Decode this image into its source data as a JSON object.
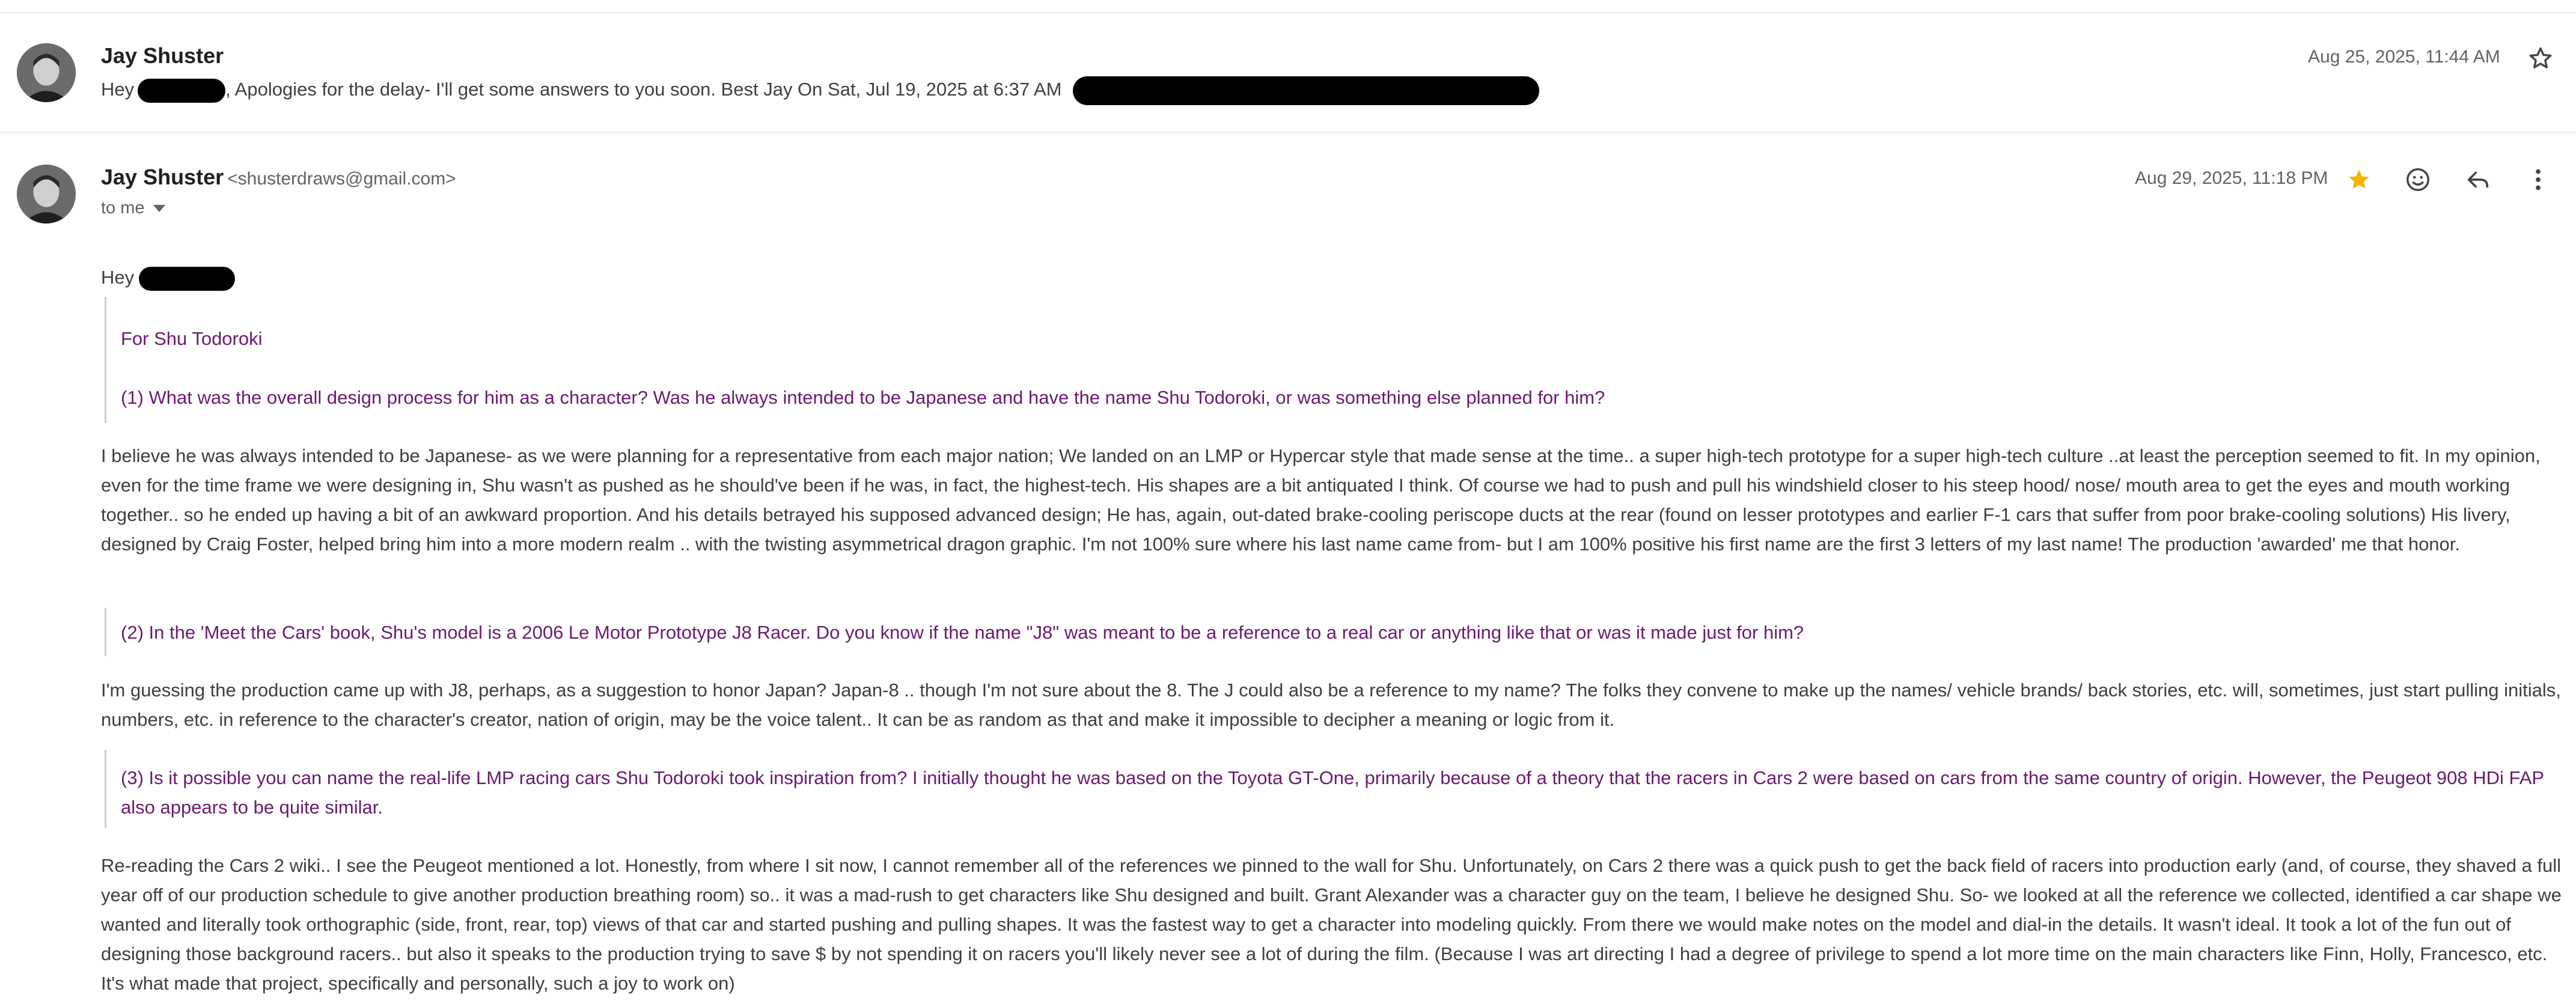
{
  "collapsed_message": {
    "sender": "Jay Shuster",
    "snippet_prefix": "Hey",
    "snippet_text": ", Apologies for the delay- I'll get some answers to you soon. Best Jay On Sat, Jul 19, 2025 at 6:37 AM",
    "date": "Aug 25, 2025, 11:44 AM",
    "star_icon": "star-outline-icon"
  },
  "expanded_message": {
    "sender": "Jay Shuster",
    "email": "<shusterdraws@gmail.com>",
    "recipient": "to me",
    "date": "Aug 29, 2025, 11:18 PM",
    "icons": [
      "star-filled-icon",
      "emoji-icon",
      "reply-icon",
      "more-vert-icon"
    ],
    "colors": {
      "star": "#f4b400",
      "quote": "#6a1b6f",
      "redaction": "#000000"
    },
    "greeting": "Hey",
    "quote_heading": "For Shu Todoroki",
    "q1": "(1) What was the overall design process for him as a character? Was he always intended to be Japanese and have the name Shu Todoroki, or was something else planned for him?",
    "a1": "I believe he was always intended to be Japanese- as we were planning for a representative from each major nation; We landed on an LMP or Hypercar style that made sense at the time.. a super high-tech prototype for a super high-tech culture ..at least the perception seemed to fit. In my opinion, even for the time frame we were designing in, Shu wasn't as pushed as he should've been if he was, in fact, the highest-tech. His shapes are a bit antiquated I think. Of course we had to push and pull his windshield closer to his steep hood/ nose/ mouth area to get the eyes and mouth working together.. so he ended up having a bit of an awkward proportion. And his details betrayed his supposed advanced design; He has, again, out-dated brake-cooling periscope ducts at the rear (found on lesser prototypes and earlier F-1 cars that suffer from poor brake-cooling solutions) His livery, designed by Craig Foster, helped bring him into a more modern realm .. with the twisting asymmetrical dragon graphic. I'm not 100% sure where his last name came from- but I am 100% positive his first name are the first 3 letters of my last name! The production 'awarded' me that honor.",
    "q2": "(2) In the 'Meet the Cars' book, Shu's model is a 2006 Le Motor Prototype J8 Racer. Do you know if the name \"J8\" was meant to be a reference to a real car or anything like that or was it  made just for him?",
    "a2": "I'm guessing the production came up with J8, perhaps, as a suggestion to honor Japan? Japan-8 .. though I'm not sure about the 8. The J could also be a reference to my name? The folks they convene to make up the names/ vehicle brands/ back stories, etc. will, sometimes, just start pulling initials, numbers, etc. in reference to the character's creator, nation of origin, may be the voice talent.. It can be as random as that and make it impossible to decipher a meaning or logic from it.",
    "q3": "(3) Is it possible you can name the real-life LMP racing cars Shu Todoroki took inspiration from? I initially thought he was based on the Toyota GT-One, primarily because of a theory that the racers in Cars 2 were based on cars from the same country of origin. However, the Peugeot 908 HDi FAP also appears to be quite similar.",
    "a3": "Re-reading the Cars 2 wiki.. I see the Peugeot mentioned a lot. Honestly, from where I sit now, I cannot remember all of the references we pinned to the wall for Shu. Unfortunately, on Cars 2 there was a quick push to get the back field of racers into production early (and, of course, they shaved a full year off of our production schedule to give another production breathing room) so.. it was a mad-rush to get characters like Shu designed and built. Grant Alexander was a character guy on the team, I believe he designed Shu. So- we looked at all the reference we collected, identified a car shape we wanted and literally took orthographic (side, front, rear, top) views of that car and started pushing and pulling shapes. It was the fastest way to get a character into modeling quickly. From there we would make notes on the model and dial-in the details. It wasn't ideal. It took a lot of the fun out of designing those background racers.. but also it speaks to the production trying to save $ by not spending it on racers you'll likely never see a lot of during the film. (Because I was art directing I had a degree of privilege to spend a lot more time on the main characters like Finn, Holly, Francesco, etc. It's what made that project, specifically and personally, such a joy to work on)"
  }
}
